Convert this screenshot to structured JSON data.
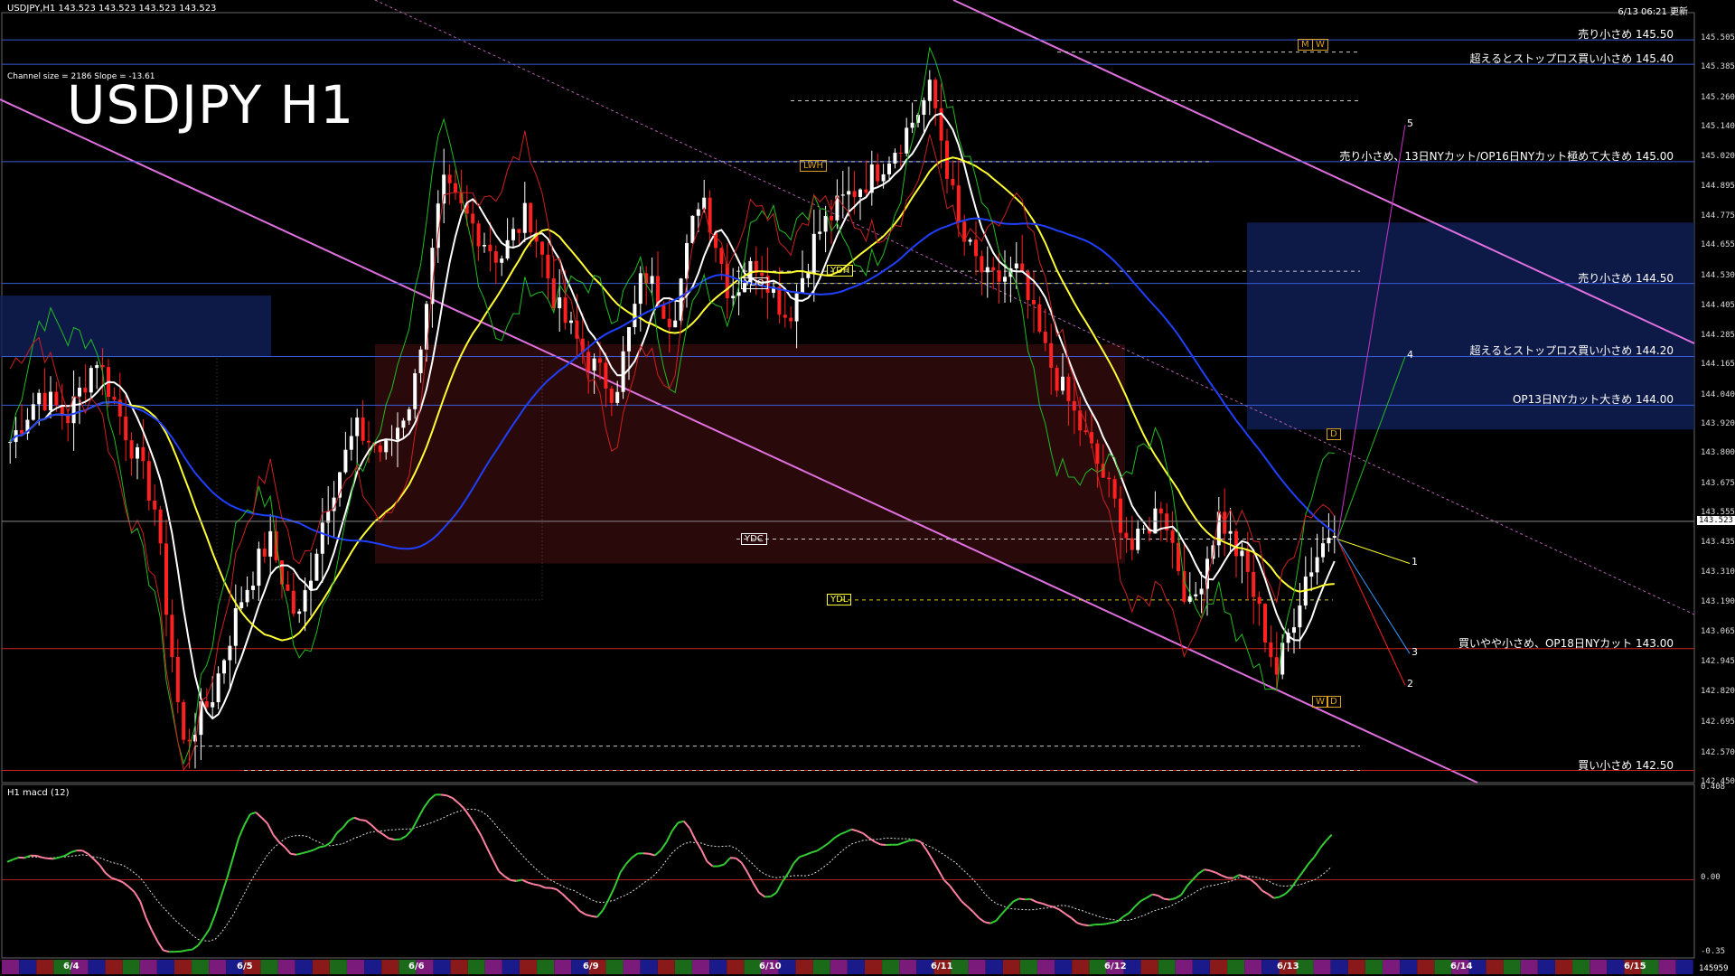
{
  "header": {
    "symbol_info": "USDJPY,H1  143.523 143.523 143.523 143.523",
    "update_time": "6/13 06:21 更新",
    "channel_info": "Channel size = 2186 Slope = -13.61",
    "title": "USDJPY H1"
  },
  "price_axis": {
    "ticks": [
      "145.505",
      "145.385",
      "145.260",
      "145.140",
      "145.020",
      "144.895",
      "144.775",
      "144.655",
      "144.530",
      "144.405",
      "144.285",
      "144.165",
      "144.040",
      "143.920",
      "143.800",
      "143.675",
      "143.555",
      "143.435",
      "143.310",
      "143.190",
      "143.065",
      "142.945",
      "142.820",
      "142.695",
      "142.570",
      "142.450"
    ],
    "current": "143.523",
    "min": 142.45,
    "max": 145.56
  },
  "levels": [
    {
      "price": 145.5,
      "text": "売り小さめ 145.50",
      "color": "#3a5bd9"
    },
    {
      "price": 145.4,
      "text": "超えるとストップロス買い小さめ 145.40",
      "color": "#3a5bd9"
    },
    {
      "price": 145.0,
      "text": "売り小さめ、13日NYカット/OP16日NYカット極めて大きめ 145.00",
      "color": "#3a5bd9"
    },
    {
      "price": 144.5,
      "text": "売り小さめ 144.50",
      "color": "#3a5bd9"
    },
    {
      "price": 144.2,
      "text": "超えるとストップロス買い小さめ 144.20",
      "color": "#3a5bd9"
    },
    {
      "price": 144.0,
      "text": "OP13日NYカット大きめ 144.00",
      "color": "#3a5bd9"
    },
    {
      "price": 143.0,
      "text": "買いやや小さめ、OP18日NYカット 143.00",
      "color": "#cc2222"
    },
    {
      "price": 142.5,
      "text": "買い小さめ 142.50",
      "color": "#cc2222"
    }
  ],
  "ref_labels": [
    {
      "text": "LWH",
      "color": "#d9a020"
    },
    {
      "text": "YDO",
      "color": "#ffffff"
    },
    {
      "text": "YDH",
      "color": "#ffff33"
    },
    {
      "text": "YDC",
      "color": "#ffffff"
    },
    {
      "text": "YDL",
      "color": "#ffff33"
    },
    {
      "text": "M",
      "color": "#d9a020"
    },
    {
      "text": "W",
      "color": "#d9a020"
    },
    {
      "text": "D",
      "color": "#d9a020"
    },
    {
      "text": "W",
      "color": "#d9a020"
    },
    {
      "text": "D",
      "color": "#d9a020"
    }
  ],
  "projections": [
    "1",
    "2",
    "3",
    "4",
    "5"
  ],
  "macd": {
    "label": "H1  macd (12)",
    "ticks": [
      "0.408",
      "0.00",
      "-0.35"
    ],
    "green": "#33cc33",
    "pink": "#ff7fa0"
  },
  "date_axis": {
    "labels": [
      "6/4",
      "6/5",
      "6/6",
      "6/9",
      "6/10",
      "6/11",
      "6/12",
      "6/13",
      "6/14",
      "6/15"
    ],
    "right_label": "145959"
  },
  "chart_data": {
    "type": "candlestick",
    "title": "USDJPY H1",
    "ylim": [
      142.45,
      145.56
    ],
    "x_categories": [
      "6/4",
      "6/5",
      "6/6",
      "6/9",
      "6/10",
      "6/11",
      "6/12",
      "6/13"
    ],
    "close_path": [
      143.85,
      144.05,
      143.95,
      144.2,
      143.9,
      143.6,
      142.6,
      142.8,
      143.2,
      143.45,
      143.1,
      143.6,
      143.9,
      143.8,
      144.05,
      144.9,
      144.75,
      144.6,
      144.8,
      144.4,
      144.2,
      144.05,
      144.55,
      144.35,
      144.9,
      144.45,
      144.6,
      144.35,
      144.7,
      144.85,
      144.95,
      145.1,
      145.3,
      144.7,
      144.5,
      144.55,
      144.2,
      143.95,
      143.7,
      143.4,
      143.6,
      143.15,
      143.55,
      143.3,
      142.9,
      143.3,
      143.52
    ],
    "current": 143.523
  }
}
